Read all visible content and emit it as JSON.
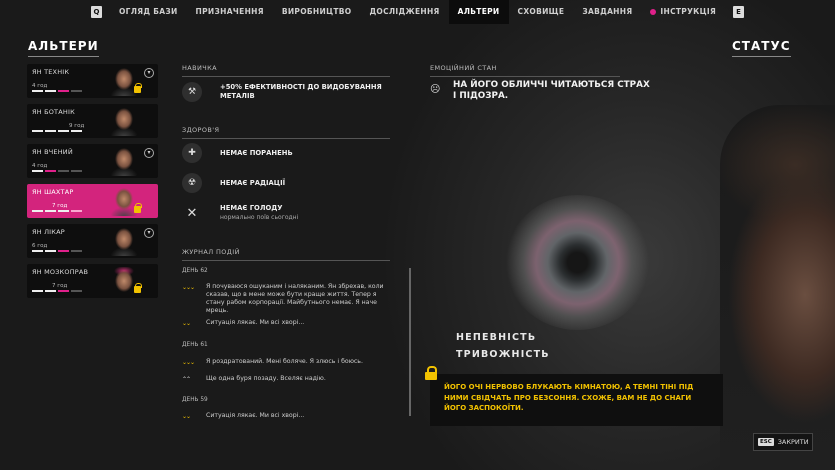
{
  "nav": {
    "key_left": "Q",
    "items": [
      "ОГЛЯД БАЗИ",
      "ПРИЗНАЧЕННЯ",
      "ВИРОБНИЦТВО",
      "ДОСЛІДЖЕННЯ",
      "АЛЬТЕРИ",
      "СХОВИЩЕ",
      "ЗАВДАННЯ",
      "ІНСТРУКЦІЯ"
    ],
    "active_index": 4,
    "key_right": "E"
  },
  "left_title": "АЛЬТЕРИ",
  "right_title": "СТАТУС",
  "alters": [
    {
      "name": "ЯН ТЕХНІК",
      "hours": "4 год",
      "selected": false,
      "locked": true,
      "chevron": true
    },
    {
      "name": "ЯН БОТАНІК",
      "hours": "9 год",
      "selected": false,
      "locked": false,
      "chevron": false
    },
    {
      "name": "ЯН ВЧЕНИЙ",
      "hours": "4 год",
      "selected": false,
      "locked": false,
      "chevron": true
    },
    {
      "name": "ЯН ШАХТАР",
      "hours": "7 год",
      "selected": true,
      "locked": true,
      "chevron": false
    },
    {
      "name": "ЯН ЛІКАР",
      "hours": "6 год",
      "selected": false,
      "locked": false,
      "chevron": true
    },
    {
      "name": "ЯН МОЗКОПРАВ",
      "hours": "7 год",
      "selected": false,
      "locked": true,
      "chevron": false
    }
  ],
  "skills": {
    "header": "НАВИЧКА",
    "text": "+50% ЕФЕКТИВНОСТІ ДО ВИДОБУВАННЯ МЕТАЛІВ",
    "icon": "pickaxe-icon"
  },
  "health": {
    "header": "ЗДОРОВ'Я",
    "items": [
      {
        "text": "НЕМАЄ ПОРАНЕНЬ",
        "sub": "",
        "icon": "bandage-icon"
      },
      {
        "text": "НЕМАЄ РАДІАЦІЇ",
        "sub": "",
        "icon": "radiation-icon"
      },
      {
        "text": "НЕМАЄ ГОЛОДУ",
        "sub": "нормально поїв сьогодні",
        "icon": "fork-knife-icon"
      }
    ]
  },
  "journal": {
    "header": "ЖУРНАЛ ПОДІЙ",
    "days": [
      {
        "day": "ДЕНЬ 62",
        "entries": [
          {
            "arrows": "⌄⌄⌄",
            "text": "Я почуваюся ошуканим і наляканим. Ян збрехав, коли сказав, що в мене може бути краще життя. Тепер я стану рабом корпорації. Майбутнього немає. Я наче мрець."
          },
          {
            "arrows": "⌄⌄",
            "text": "Ситуація лякає. Ми всі хворі..."
          }
        ]
      },
      {
        "day": "ДЕНЬ 61",
        "entries": [
          {
            "arrows": "⌄⌄⌄",
            "text": "Я роздратований. Мені боляче. Я злюсь і боюсь."
          },
          {
            "arrows": "⌃⌃",
            "text": "Ще одна буря позаду. Вселяє надію."
          }
        ]
      },
      {
        "day": "ДЕНЬ 59",
        "entries": [
          {
            "arrows": "⌄⌄",
            "text": "Ситуація лякає. Ми всі хворі..."
          }
        ]
      }
    ]
  },
  "emotional": {
    "header": "ЕМОЦІЙНИЙ СТАН",
    "text": "НА ЙОГО ОБЛИЧЧІ ЧИТАЮТЬСЯ СТРАХ І ПІДОЗРА.",
    "icon": "sad-face-icon"
  },
  "traits": [
    "НЕПЕВНІСТЬ",
    "ТРИВОЖНІСТЬ"
  ],
  "warning": {
    "text": "ЙОГО ОЧІ НЕРВОВО БЛУКАЮТЬ КІМНАТОЮ, А ТЕМНІ ТІНІ ПІД НИМИ СВІДЧАТЬ ПРО БЕЗСОННЯ. СХОЖЕ, ВАМ НЕ ДО СНАГИ ЙОГО ЗАСПОКОЇТИ.",
    "color": "#f2c200"
  },
  "close": {
    "key": "ESC",
    "label": "ЗАКРИТИ"
  },
  "colors": {
    "accent": "#d3247d",
    "warning": "#f2c200"
  }
}
